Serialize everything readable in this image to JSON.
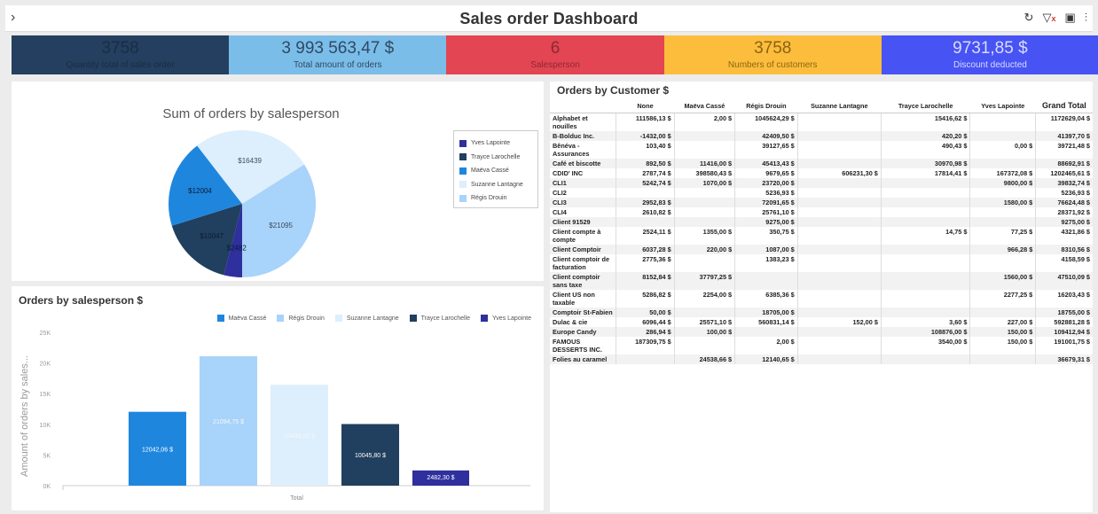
{
  "header": {
    "title": "Sales order Dashboard"
  },
  "kpis": [
    {
      "value": "3758",
      "label": "Quantity total of sales order",
      "bg": "#243f5f",
      "fg": "#1a2d44"
    },
    {
      "value": "3 993 563,47 $",
      "label": "Total amount of orders",
      "bg": "#7bbde9",
      "fg": "#2e4a63"
    },
    {
      "value": "6",
      "label": "Salesperson",
      "bg": "#e34552",
      "fg": "#8a2a33"
    },
    {
      "value": "3758",
      "label": "Numbers of customers",
      "bg": "#fdbd3c",
      "fg": "#8a6414"
    },
    {
      "value": "9731,85 $",
      "label": "Discount deducted",
      "bg": "#4853f3",
      "fg": "#d8dcff"
    }
  ],
  "colors": {
    "yves": "#2f2f9e",
    "trayce": "#213f5e",
    "maeva": "#1f86de",
    "suzanne": "#ddeefc",
    "regis": "#a8d3fa"
  },
  "pie": {
    "title": "Sum of orders by salesperson",
    "legend": [
      "Yves Lapointe",
      "Trayce Larochelle",
      "Maëva Cassé",
      "Suzanne Lantagne",
      "Régis Drouin"
    ]
  },
  "bar": {
    "title": "Orders by salesperson $",
    "ylabel": "Amount of orders by sales...",
    "xlabel": "Total",
    "legend": [
      "Maëva Cassé",
      "Régis Drouin",
      "Suzanne Lantagne",
      "Trayce Larochelle",
      "Yves Lapointe"
    ]
  },
  "chart_data": [
    {
      "type": "pie",
      "title": "Sum of orders by salesperson",
      "labels": [
        "Yves Lapointe",
        "Trayce Larochelle",
        "Maëva Cassé",
        "Suzanne Lantagne",
        "Régis Drouin"
      ],
      "values": [
        2482,
        10047,
        12004,
        16439,
        21095
      ],
      "slice_labels": [
        "$2482",
        "$10047",
        "$12004",
        "$16439",
        "$21095"
      ],
      "legend": "right"
    },
    {
      "type": "bar",
      "title": "Orders by salesperson $",
      "xlabel": "Total",
      "ylabel": "Amount of orders by sales...",
      "categories": [
        "Total"
      ],
      "series": [
        {
          "name": "Maëva Cassé",
          "values": [
            12042.06
          ],
          "label": "12042,06 $"
        },
        {
          "name": "Régis Drouin",
          "values": [
            21094.75
          ],
          "label": "21094,75 $"
        },
        {
          "name": "Suzanne Lantagne",
          "values": [
            16439
          ],
          "label": "16439,00 $"
        },
        {
          "name": "Trayce Larochelle",
          "values": [
            10045.8
          ],
          "label": "10045,80 $"
        },
        {
          "name": "Yves Lapointe",
          "values": [
            2482.3
          ],
          "label": "2482,30 $"
        }
      ],
      "yticks": [
        "0K",
        "5K",
        "10K",
        "15K",
        "20K",
        "25K"
      ],
      "ylim": [
        0,
        25000
      ],
      "legend": "top-right"
    }
  ],
  "table": {
    "title": "Orders by Customer $",
    "columns": [
      "",
      "None",
      "Maëva Cassé",
      "Régis Drouin",
      "Suzanne Lantagne",
      "Trayce Larochelle",
      "Yves Lapointe",
      "Grand Total"
    ],
    "rows": [
      [
        "Alphabet et nouilles",
        "111586,13 $",
        "2,00 $",
        "1045624,29 $",
        "",
        "15416,62 $",
        "",
        "1172629,04 $"
      ],
      [
        "B-Bolduc Inc.",
        "-1432,00 $",
        "",
        "42409,50 $",
        "",
        "420,20 $",
        "",
        "41397,70 $"
      ],
      [
        "Bênéva - Assurances",
        "103,40 $",
        "",
        "39127,65 $",
        "",
        "490,43 $",
        "0,00 $",
        "39721,48 $"
      ],
      [
        "Café et biscotte",
        "892,50 $",
        "11416,00 $",
        "45413,43 $",
        "",
        "30970,98 $",
        "",
        "88692,91 $"
      ],
      [
        "CDID' INC",
        "2787,74 $",
        "398580,43 $",
        "9679,65 $",
        "606231,30 $",
        "17814,41 $",
        "167372,08 $",
        "1202465,61 $"
      ],
      [
        "CLI1",
        "5242,74 $",
        "1070,00 $",
        "23720,00 $",
        "",
        "",
        "9800,00 $",
        "39832,74 $"
      ],
      [
        "CLI2",
        "",
        "",
        "5236,93 $",
        "",
        "",
        "",
        "5236,93 $"
      ],
      [
        "CLI3",
        "2952,83 $",
        "",
        "72091,65 $",
        "",
        "",
        "1580,00 $",
        "76624,48 $"
      ],
      [
        "CLI4",
        "2610,82 $",
        "",
        "25761,10 $",
        "",
        "",
        "",
        "28371,92 $"
      ],
      [
        "Client 91529",
        "",
        "",
        "9275,00 $",
        "",
        "",
        "",
        "9275,00 $"
      ],
      [
        "Client compte à compte",
        "2524,11 $",
        "1355,00 $",
        "350,75 $",
        "",
        "14,75 $",
        "77,25 $",
        "4321,86 $"
      ],
      [
        "Client Comptoir",
        "6037,28 $",
        "220,00 $",
        "1087,00 $",
        "",
        "",
        "966,28 $",
        "8310,56 $"
      ],
      [
        "Client comptoir de facturation",
        "2775,36 $",
        "",
        "1383,23 $",
        "",
        "",
        "",
        "4158,59 $"
      ],
      [
        "Client comptoir sans taxe",
        "8152,84 $",
        "37797,25 $",
        "",
        "",
        "",
        "1560,00 $",
        "47510,09 $"
      ],
      [
        "Client US non taxable",
        "5286,82 $",
        "2254,00 $",
        "6385,36 $",
        "",
        "",
        "2277,25 $",
        "16203,43 $"
      ],
      [
        "Comptoir St-Fabien",
        "50,00 $",
        "",
        "18705,00 $",
        "",
        "",
        "",
        "18755,00 $"
      ],
      [
        "Dulac & cie",
        "6096,44 $",
        "25571,10 $",
        "560831,14 $",
        "152,00 $",
        "3,60 $",
        "227,00 $",
        "592881,28 $"
      ],
      [
        "Europe Candy",
        "286,94 $",
        "100,00 $",
        "",
        "",
        "108876,00 $",
        "150,00 $",
        "109412,94 $"
      ],
      [
        "FAMOUS DESSERTS INC.",
        "187309,75 $",
        "",
        "2,00 $",
        "",
        "3540,00 $",
        "150,00 $",
        "191001,75 $"
      ],
      [
        "Folies au caramel",
        "",
        "24538,66 $",
        "12140,65 $",
        "",
        "",
        "",
        "36679,31 $"
      ]
    ]
  }
}
